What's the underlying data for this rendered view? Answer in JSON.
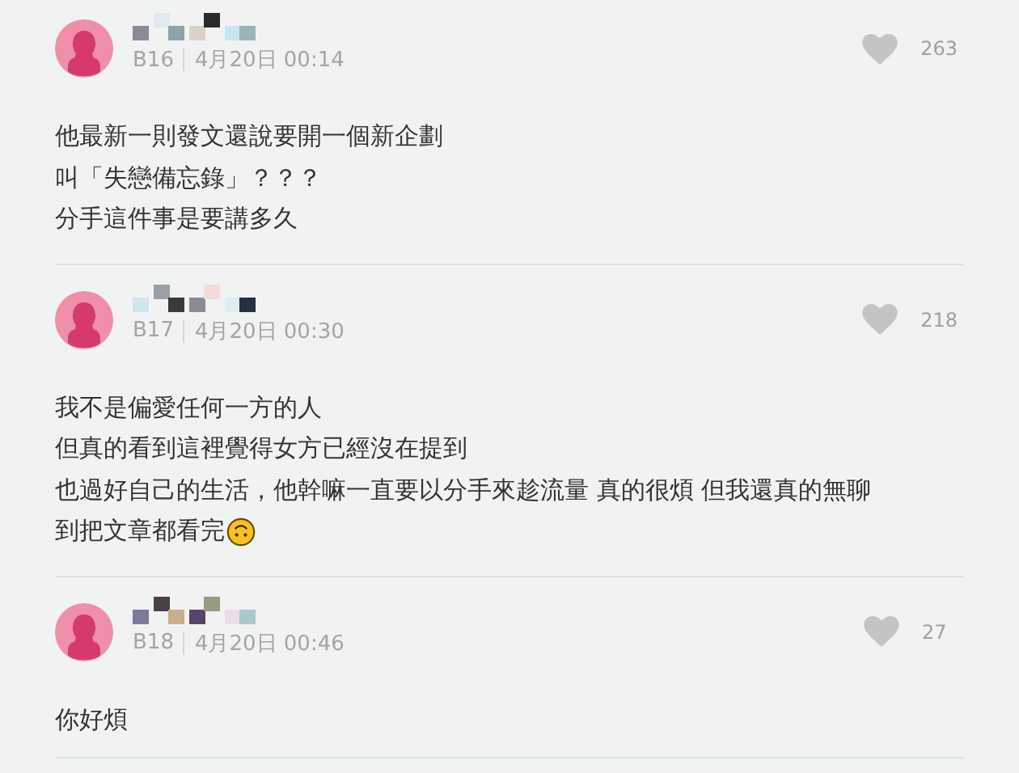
{
  "comments": [
    {
      "floor": "B16",
      "time": "4月20日 00:14",
      "likes": "263",
      "lines": [
        "他最新一則發文還說要開一個新企劃",
        "叫「失戀備忘錄」？？？",
        "分手這件事是要講多久"
      ],
      "trailing_emoji": false
    },
    {
      "floor": "B17",
      "time": "4月20日 00:30",
      "likes": "218",
      "lines": [
        "我不是偏愛任何一方的人",
        "但真的看到這裡覺得女方已經沒在提到",
        "也過好自己的生活，他幹嘛一直要以分手來趁流量 真的很煩 但我還真的無聊",
        "到把文章都看完"
      ],
      "trailing_emoji": true
    },
    {
      "floor": "B18",
      "time": "4月20日 00:46",
      "likes": "27",
      "lines": [
        "你好煩"
      ],
      "trailing_emoji": false
    }
  ]
}
